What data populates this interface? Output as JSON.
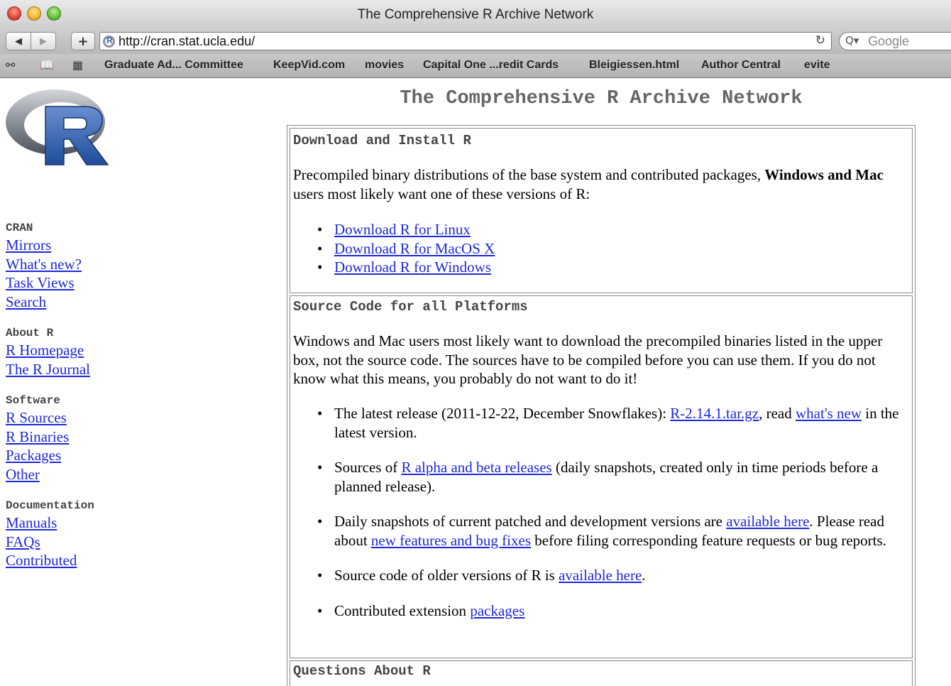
{
  "window": {
    "title": "The Comprehensive R Archive Network"
  },
  "toolbar": {
    "back_icon": "◀",
    "forward_icon": "▶",
    "add_icon": "+",
    "url": "http://cran.stat.ucla.edu/",
    "reload_icon": "↻",
    "search_icon": "Q▾",
    "search_placeholder": "Google"
  },
  "bookmarks": {
    "items": [
      "Graduate Ad... Committee",
      "KeepVid.com",
      "movies",
      "Capital One ...redit Cards",
      "Bleigiessen.html",
      "Author Central",
      "evite"
    ]
  },
  "sidebar": {
    "groups": [
      {
        "heading": "CRAN",
        "links": [
          "Mirrors",
          "What's new?",
          "Task Views",
          "Search"
        ]
      },
      {
        "heading": "About R",
        "links": [
          "R Homepage",
          "The R Journal"
        ]
      },
      {
        "heading": "Software",
        "links": [
          "R Sources",
          "R Binaries",
          "Packages",
          "Other"
        ]
      },
      {
        "heading": "Documentation",
        "links": [
          "Manuals",
          "FAQs",
          "Contributed"
        ]
      }
    ]
  },
  "main": {
    "title": "The Comprehensive R Archive Network",
    "download": {
      "heading": "Download and Install R",
      "intro_1": "Precompiled binary distributions of the base system and contributed packages, ",
      "intro_bold": "Windows and Mac",
      "intro_2": " users most likely want one of these versions of R:",
      "links": [
        "Download R for Linux",
        "Download R for MacOS X",
        "Download R for Windows"
      ]
    },
    "source": {
      "heading": "Source Code for all Platforms",
      "intro": "Windows and Mac users most likely want to download the precompiled binaries listed in the upper box, not the source code. The sources have to be compiled before you can use them. If you do not know what this means, you probably do not want to do it!",
      "item1_a": "The latest release (2011-12-22, December Snowflakes): ",
      "item1_link1": "R-2.14.1.tar.gz",
      "item1_b": ", read ",
      "item1_link2": "what's new",
      "item1_c": " in the latest version.",
      "item2_a": "Sources of ",
      "item2_link": "R alpha and beta releases",
      "item2_b": " (daily snapshots, created only in time periods before a planned release).",
      "item3_a": "Daily snapshots of current patched and development versions are ",
      "item3_link1": "available here",
      "item3_b": ". Please read about ",
      "item3_link2": "new features and bug fixes",
      "item3_c": " before filing corresponding feature requests or bug reports.",
      "item4_a": "Source code of older versions of R is ",
      "item4_link": "available here",
      "item4_b": ".",
      "item5_a": "Contributed extension ",
      "item5_link": "packages"
    },
    "questions": {
      "heading": "Questions About R"
    }
  }
}
